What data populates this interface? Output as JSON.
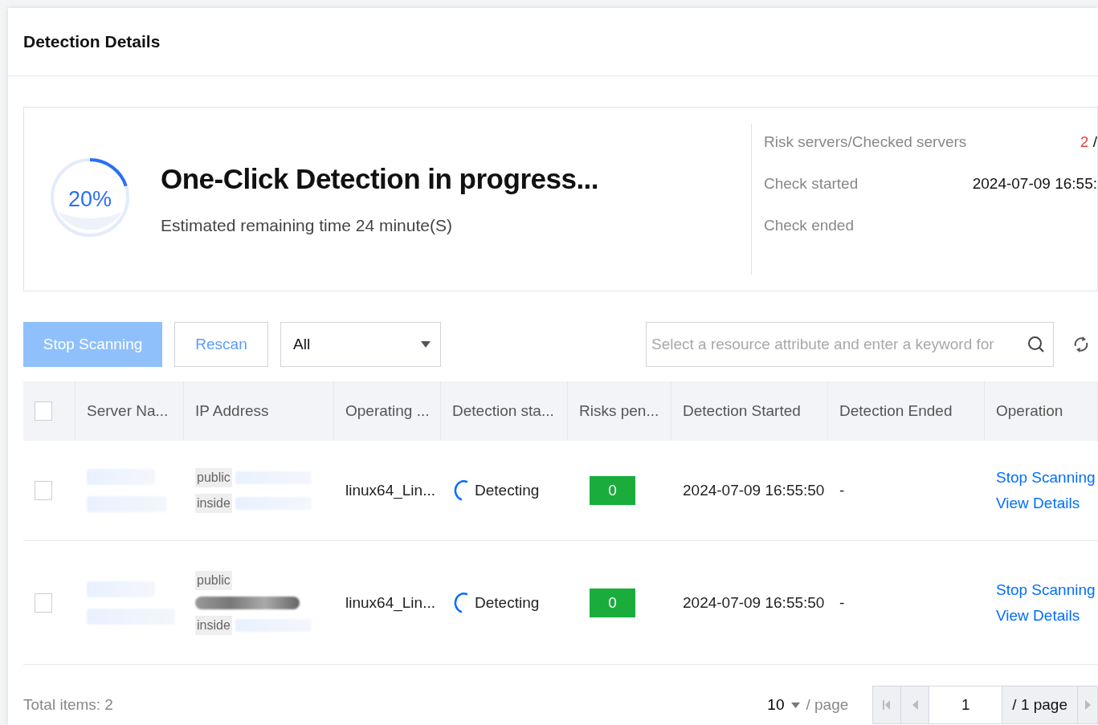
{
  "header": {
    "title": "Detection Details"
  },
  "progress": {
    "level": 0.2,
    "percent": "20%",
    "title": "One-Click Detection in progress...",
    "subtitle": "Estimated remaining time 24 minute(S)"
  },
  "summary": [
    {
      "label": "Risk servers/Checked servers",
      "value": "2",
      "rest": "/",
      "alert": true
    },
    {
      "label": "Check started",
      "value": "2024-07-09 16:55:",
      "alert": false
    },
    {
      "label": "Check ended"
    }
  ],
  "toolbar": {
    "stop_button": {
      "label": "Stop Scanning",
      "disabled": true
    },
    "rescan_button": "Rescan",
    "filter": "All",
    "search": {
      "placeholder": "Select a resource attribute and enter a keyword for"
    }
  },
  "table": {
    "all_checked": false,
    "columns": [
      "Server Na...",
      "IP Address",
      "Operating ...",
      "Detection sta...",
      "Risks pen...",
      "Detection Started",
      "Detection Ended",
      "Operation"
    ],
    "rows": [
      {
        "checked": false,
        "ips": [
          "public",
          "inside"
        ],
        "os": "linux64_Lin...",
        "status": "Detecting",
        "risks": "0",
        "started": "2024-07-09 16:55:50",
        "ended": "-",
        "actions": [
          "Stop Scanning",
          "View Details"
        ]
      },
      {
        "checked": false,
        "ips": [
          "public",
          "inside"
        ],
        "os": "linux64_Lin...",
        "status": "Detecting",
        "risks": "0",
        "started": "2024-07-09 16:55:50",
        "ended": "-",
        "actions": [
          "Stop Scanning",
          "View Details"
        ]
      }
    ]
  },
  "footer": {
    "total": "Total items: 2",
    "page_size": "10",
    "per_page": "/ page",
    "page": "1",
    "page_total": "/ 1 page"
  }
}
